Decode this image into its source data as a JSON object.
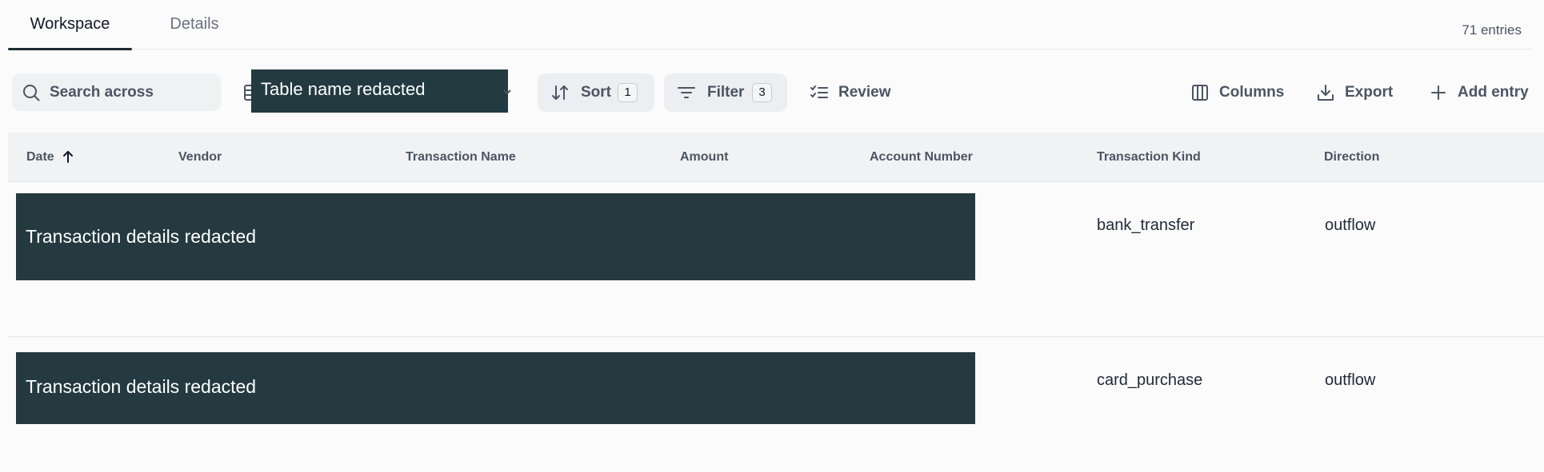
{
  "tabs": [
    {
      "label": "Workspace",
      "active": true
    },
    {
      "label": "Details",
      "active": false
    }
  ],
  "entries_count": "71 entries",
  "toolbar": {
    "search_placeholder": "Search across",
    "table_name": "Table name redacted",
    "sort_label": "Sort",
    "sort_count": "1",
    "filter_label": "Filter",
    "filter_count": "3",
    "review_label": "Review",
    "columns_label": "Columns",
    "export_label": "Export",
    "add_label": "Add entry"
  },
  "table": {
    "columns": [
      "Date",
      "Vendor",
      "Transaction Name",
      "Amount",
      "Account Number",
      "Transaction Kind",
      "Direction"
    ],
    "sort_direction": "ascending",
    "rows": [
      {
        "redacted_text": "Transaction details redacted",
        "transaction_kind": "bank_transfer",
        "direction": "outflow"
      },
      {
        "redacted_text": "Transaction details redacted",
        "transaction_kind": "card_purchase",
        "direction": "outflow"
      }
    ]
  },
  "colors": {
    "redaction": "#243a40",
    "active_tab_underline": "#1e2b33",
    "header_bg": "#f1f2f4"
  },
  "icons": {
    "search": "search-icon",
    "table": "table-icon",
    "sort": "sort-arrows-icon",
    "filter": "filter-lines-icon",
    "review": "checklist-icon",
    "columns": "columns-icon",
    "export": "download-icon",
    "add": "plus-icon"
  }
}
